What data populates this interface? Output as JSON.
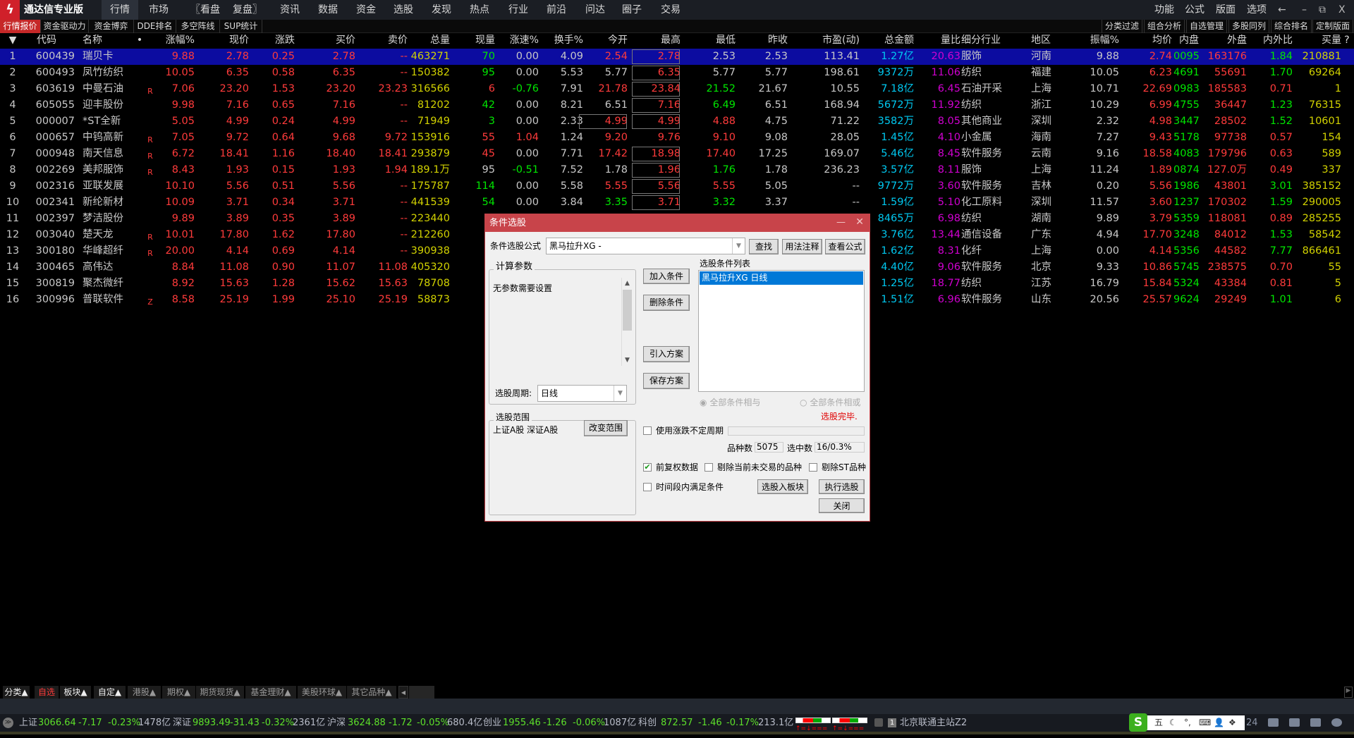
{
  "app": {
    "title": "通达信专业版",
    "logo_icon": "tdx-logo-icon"
  },
  "menu": [
    "行情",
    "市场",
    "〖看盘",
    "复盘〗",
    "资讯",
    "数据",
    "资金",
    "选股",
    "发现",
    "热点",
    "行业",
    "前沿",
    "问达",
    "圈子",
    "交易"
  ],
  "menu_right": [
    "功能",
    "公式",
    "版面",
    "选项"
  ],
  "window_controls": [
    "←",
    "–",
    "⧉",
    "X"
  ],
  "tabs_left": [
    "行情报价",
    "资金驱动力",
    "资金博弈",
    "DDE排名",
    "多空阵线",
    "SUP统计"
  ],
  "tabs_right": [
    "分类过滤",
    "组合分析",
    "自选管理",
    "多股同列",
    "综合排名",
    "定制版面"
  ],
  "columns": [
    "▼",
    "代码",
    "名称",
    "•",
    "涨幅%",
    "现价",
    "涨跌",
    "买价",
    "卖价",
    "总量",
    "现量",
    "涨速%",
    "换手%",
    "今开",
    "最高",
    "最低",
    "昨收",
    "市盈(动)",
    "总金额",
    "量比",
    "细分行业",
    "地区",
    "振幅%",
    "均价",
    "内盘",
    "外盘",
    "内外比",
    "买量",
    "?"
  ],
  "rows": [
    {
      "v": [
        "1",
        "600439",
        "瑞贝卡",
        "",
        "9.88",
        "2.78",
        "0.25",
        "2.78",
        "--",
        "463271",
        "70",
        "0.00",
        "4.09",
        "2.54",
        "2.78",
        "2.53",
        "2.53",
        "113.41",
        "1.27亿",
        "20.63",
        "服饰",
        "河南",
        "9.88",
        "2.74",
        "0095",
        "163176",
        "1.84",
        "210881"
      ],
      "c": "wwwrrrrrrygwwrrwwwcmwwwrgrgy",
      "boxed": [
        14
      ]
    },
    {
      "v": [
        "2",
        "600493",
        "凤竹纺织",
        "",
        "10.05",
        "6.35",
        "0.58",
        "6.35",
        "--",
        "150382",
        "95",
        "0.00",
        "5.53",
        "5.77",
        "6.35",
        "5.77",
        "5.77",
        "198.61",
        "9372万",
        "11.06",
        "纺织",
        "福建",
        "10.05",
        "6.23",
        "4691",
        "55691",
        "1.70",
        "69264"
      ],
      "c": "wwwrrrrrrygwwwrwwwcmwwwrgrgy",
      "boxed": [
        14
      ]
    },
    {
      "v": [
        "3",
        "603619",
        "中曼石油",
        "R",
        "7.06",
        "23.20",
        "1.53",
        "23.20",
        "23.23",
        "316566",
        "6",
        "-0.76",
        "7.91",
        "21.78",
        "23.84",
        "21.52",
        "21.67",
        "10.55",
        "7.18亿",
        "6.45",
        "石油开采",
        "上海",
        "10.71",
        "22.69",
        "0983",
        "185583",
        "0.71",
        "1"
      ],
      "c": "wwwrrrrrryrgwrrgwwcmwwwrgrry",
      "boxed": [
        14
      ]
    },
    {
      "v": [
        "4",
        "605055",
        "迎丰股份",
        "",
        "9.98",
        "7.16",
        "0.65",
        "7.16",
        "--",
        "81202",
        "42",
        "0.00",
        "8.21",
        "6.51",
        "7.16",
        "6.49",
        "6.51",
        "168.94",
        "5672万",
        "11.92",
        "纺织",
        "浙江",
        "10.29",
        "6.99",
        "4755",
        "36447",
        "1.23",
        "76315"
      ],
      "c": "wwwrrrrrrygwwwrgwwcmwwwrgrgy",
      "boxed": [
        14
      ]
    },
    {
      "v": [
        "5",
        "000007",
        "*ST全新",
        "",
        "5.05",
        "4.99",
        "0.24",
        "4.99",
        "--",
        "71949",
        "3",
        "0.00",
        "2.33",
        "4.99",
        "4.99",
        "4.88",
        "4.75",
        "71.22",
        "3582万",
        "8.05",
        "其他商业",
        "深圳",
        "2.32",
        "4.98",
        "3447",
        "28502",
        "1.52",
        "10601"
      ],
      "c": "wwwrrrrrrygwwrrrwwcmwwwrgrgy",
      "boxed": [
        13,
        14
      ]
    },
    {
      "v": [
        "6",
        "000657",
        "中钨高新",
        "R",
        "7.05",
        "9.72",
        "0.64",
        "9.68",
        "9.72",
        "153916",
        "55",
        "1.04",
        "1.24",
        "9.20",
        "9.76",
        "9.10",
        "9.08",
        "28.05",
        "1.45亿",
        "4.10",
        "小金属",
        "海南",
        "7.27",
        "9.43",
        "5178",
        "97738",
        "0.57",
        "154"
      ],
      "c": "wwwrrrrrryrrwrrrwwcmwwwrgrry",
      "boxed": []
    },
    {
      "v": [
        "7",
        "000948",
        "南天信息",
        "R",
        "6.72",
        "18.41",
        "1.16",
        "18.40",
        "18.41",
        "293879",
        "45",
        "0.00",
        "7.71",
        "17.42",
        "18.98",
        "17.40",
        "17.25",
        "169.07",
        "5.46亿",
        "8.45",
        "软件服务",
        "云南",
        "9.16",
        "18.58",
        "4083",
        "179796",
        "0.63",
        "589"
      ],
      "c": "wwwrrrrrryrwwrrrwwcmwwwrgrry",
      "boxed": [
        14
      ]
    },
    {
      "v": [
        "8",
        "002269",
        "美邦服饰",
        "R",
        "8.43",
        "1.93",
        "0.15",
        "1.93",
        "1.94",
        "189.1万",
        "95",
        "-0.51",
        "7.52",
        "1.78",
        "1.96",
        "1.76",
        "1.78",
        "236.23",
        "3.57亿",
        "8.11",
        "服饰",
        "上海",
        "11.24",
        "1.89",
        "0874",
        "127.0万",
        "0.49",
        "337"
      ],
      "c": "wwwrrrrrrywgwwrgwwcmwwwrgrry",
      "boxed": [
        14
      ]
    },
    {
      "v": [
        "9",
        "002316",
        "亚联发展",
        "",
        "10.10",
        "5.56",
        "0.51",
        "5.56",
        "--",
        "175787",
        "114",
        "0.00",
        "5.58",
        "5.55",
        "5.56",
        "5.55",
        "5.05",
        "--",
        "9772万",
        "3.60",
        "软件服务",
        "吉林",
        "0.20",
        "5.56",
        "1986",
        "43801",
        "3.01",
        "385152"
      ],
      "c": "wwwrrrrrrygwwrrrwwcmwwwrgrgy",
      "boxed": [
        14
      ]
    },
    {
      "v": [
        "10",
        "002341",
        "新纶新材",
        "",
        "10.09",
        "3.71",
        "0.34",
        "3.71",
        "--",
        "441539",
        "54",
        "0.00",
        "3.84",
        "3.35",
        "3.71",
        "3.32",
        "3.37",
        "--",
        "1.59亿",
        "5.10",
        "化工原料",
        "深圳",
        "11.57",
        "3.60",
        "1237",
        "170302",
        "1.59",
        "290005"
      ],
      "c": "wwwrrrrrrygwwgrgwwcmwwwrgrgy",
      "boxed": [
        14
      ]
    },
    {
      "v": [
        "11",
        "002397",
        "梦洁股份",
        "",
        "9.89",
        "3.89",
        "0.35",
        "3.89",
        "--",
        "223440",
        "",
        "",
        "",
        "",
        "",
        "",
        "",
        "",
        "8465万",
        "6.98",
        "纺织",
        "湖南",
        "9.89",
        "3.79",
        "5359",
        "118081",
        "0.89",
        "285255"
      ],
      "c": "wwwrrrrrrywwwwwwwwcmwwwrgrry",
      "boxed": []
    },
    {
      "v": [
        "12",
        "003040",
        "楚天龙",
        "R",
        "10.01",
        "17.80",
        "1.62",
        "17.80",
        "--",
        "212260",
        "",
        "",
        "",
        "",
        "",
        "",
        "",
        "",
        "3.76亿",
        "13.44",
        "通信设备",
        "广东",
        "4.94",
        "17.70",
        "3248",
        "84012",
        "1.53",
        "58542"
      ],
      "c": "wwwrrrrrrywwwwwwwwcmwwwrgrgy",
      "boxed": []
    },
    {
      "v": [
        "13",
        "300180",
        "华峰超纤",
        "R",
        "20.00",
        "4.14",
        "0.69",
        "4.14",
        "--",
        "390938",
        "",
        "",
        "",
        "",
        "",
        "",
        "",
        "",
        "1.62亿",
        "8.31",
        "化纤",
        "上海",
        "0.00",
        "4.14",
        "5356",
        "44582",
        "7.77",
        "866461"
      ],
      "c": "wwwrrrrrrywwwwwwwwcmwwwrgrgy",
      "boxed": []
    },
    {
      "v": [
        "14",
        "300465",
        "高伟达",
        "",
        "8.84",
        "11.08",
        "0.90",
        "11.07",
        "11.08",
        "405320",
        "",
        "",
        "",
        "",
        "",
        "",
        "",
        "",
        "4.40亿",
        "9.06",
        "软件服务",
        "北京",
        "9.33",
        "10.86",
        "5745",
        "238575",
        "0.70",
        "55"
      ],
      "c": "wwwrrrrrrywwwwwwwwcmwwwrgrry",
      "boxed": []
    },
    {
      "v": [
        "15",
        "300819",
        "聚杰微纤",
        "",
        "8.92",
        "15.63",
        "1.28",
        "15.62",
        "15.63",
        "78708",
        "",
        "",
        "",
        "",
        "",
        "",
        "",
        "",
        "1.25亿",
        "18.77",
        "纺织",
        "江苏",
        "16.79",
        "15.84",
        "5324",
        "43384",
        "0.81",
        "5"
      ],
      "c": "wwwrrrrrrywwwwwwwwcmwwwrgrry",
      "boxed": []
    },
    {
      "v": [
        "16",
        "300996",
        "普联软件",
        "Z",
        "8.58",
        "25.19",
        "1.99",
        "25.10",
        "25.19",
        "58873",
        "",
        "",
        "",
        "",
        "",
        "",
        "",
        "",
        "1.51亿",
        "6.96",
        "软件服务",
        "山东",
        "20.56",
        "25.57",
        "9624",
        "29249",
        "1.01",
        "6"
      ],
      "c": "wwwrrrrrrywwwwwwwwcmwwwrgrgy",
      "boxed": []
    }
  ],
  "bottom_tabs": [
    "分类▲",
    "自选",
    "板块▲",
    "自定▲",
    "港股▲",
    "期权▲",
    "期货现货▲",
    "基金理财▲",
    "美股环球▲",
    "其它品种▲"
  ],
  "indices": [
    {
      "name": "上证",
      "value": "3066.64",
      "change": "-7.17",
      "pct": "-0.23%",
      "amount": "1478亿"
    },
    {
      "name": "深证",
      "value": "9893.49",
      "change": "-31.43",
      "pct": "-0.32%",
      "amount": "2361亿"
    },
    {
      "name": "沪深",
      "value": "3624.88",
      "change": "-1.72",
      "pct": "-0.05%",
      "amount": "680.4亿"
    },
    {
      "name": "创业",
      "value": "1955.46",
      "change": "-1.26",
      "pct": "-0.06%",
      "amount": "1087亿"
    },
    {
      "name": "科创",
      "value": "872.57",
      "change": "-1.46",
      "pct": "-0.17%",
      "amount": "213.1亿"
    }
  ],
  "status": {
    "server": "北京联通主站Z2",
    "server_index": "1",
    "time_fragment": "24",
    "ime": [
      "五",
      "☾",
      "°,",
      "⌨",
      "👤",
      "❖"
    ]
  },
  "dialog": {
    "title": "条件选股",
    "formula_label": "条件选股公式",
    "formula_value": "黑马拉升XG   -",
    "find": "查找",
    "usage": "用法注释",
    "view_formula": "查看公式",
    "params_group": "计算参数",
    "params_text": "无参数需要设置",
    "period_label": "选股周期:",
    "period_value": "日线",
    "add": "加入条件",
    "delete": "删除条件",
    "import": "引入方案",
    "save": "保存方案",
    "list_label": "选股条件列表",
    "list_items": [
      "黑马拉升XG  日线"
    ],
    "radio_and": "全部条件相与",
    "radio_or": "全部条件相或",
    "done": "选股完毕.",
    "use_period": "使用涨跌不定周期",
    "count_label": "品种数",
    "count_value": "5075",
    "selected_label": "选中数",
    "selected_value": "16/0.3%",
    "fq": "前复权数据",
    "fq_checked": true,
    "exclude_untraded": "剔除当前未交易的品种",
    "exclude_st": "剔除ST品种",
    "time_cond": "时间段内满足条件",
    "to_block": "选股入板块",
    "execute": "执行选股",
    "close": "关闭",
    "range_group": "选股范围",
    "range_text": "上证A股 深证A股",
    "change_range": "改变范围"
  }
}
